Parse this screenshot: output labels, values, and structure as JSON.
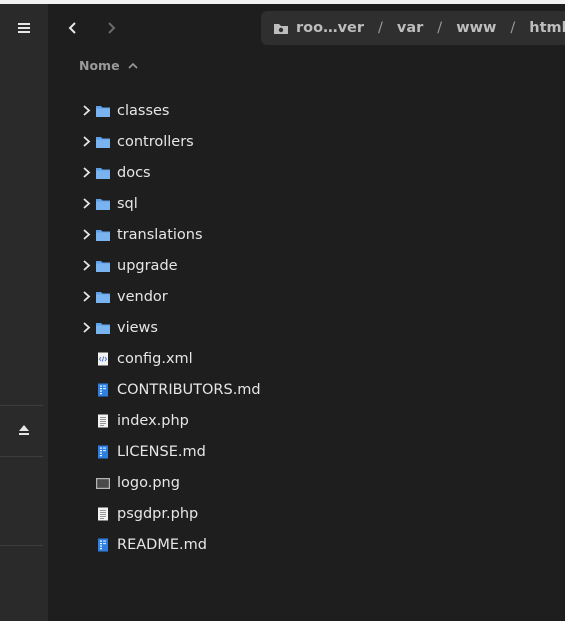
{
  "sidebar": {
    "menu_icon": "hamburger-menu-icon",
    "eject_icon": "eject-icon"
  },
  "toolbar": {
    "back_icon": "chevron-left-icon",
    "forward_icon": "chevron-right-icon"
  },
  "breadcrumb": {
    "segments": [
      "roo…ver",
      "var",
      "www",
      "html"
    ],
    "separator": "/"
  },
  "column_header": {
    "name_label": "Nome",
    "sort_icon": "chevron-up-icon"
  },
  "files": [
    {
      "name": "classes",
      "type": "folder"
    },
    {
      "name": "controllers",
      "type": "folder"
    },
    {
      "name": "docs",
      "type": "folder"
    },
    {
      "name": "sql",
      "type": "folder"
    },
    {
      "name": "translations",
      "type": "folder"
    },
    {
      "name": "upgrade",
      "type": "folder"
    },
    {
      "name": "vendor",
      "type": "folder"
    },
    {
      "name": "views",
      "type": "folder"
    },
    {
      "name": "config.xml",
      "type": "xml"
    },
    {
      "name": "CONTRIBUTORS.md",
      "type": "markdown"
    },
    {
      "name": "index.php",
      "type": "text"
    },
    {
      "name": "LICENSE.md",
      "type": "markdown"
    },
    {
      "name": "logo.png",
      "type": "image"
    },
    {
      "name": "psgdpr.php",
      "type": "text"
    },
    {
      "name": "README.md",
      "type": "markdown"
    }
  ],
  "colors": {
    "folder": "#5e9fe6",
    "background": "#1e1e1e",
    "sidebar": "#2a2a2a"
  }
}
